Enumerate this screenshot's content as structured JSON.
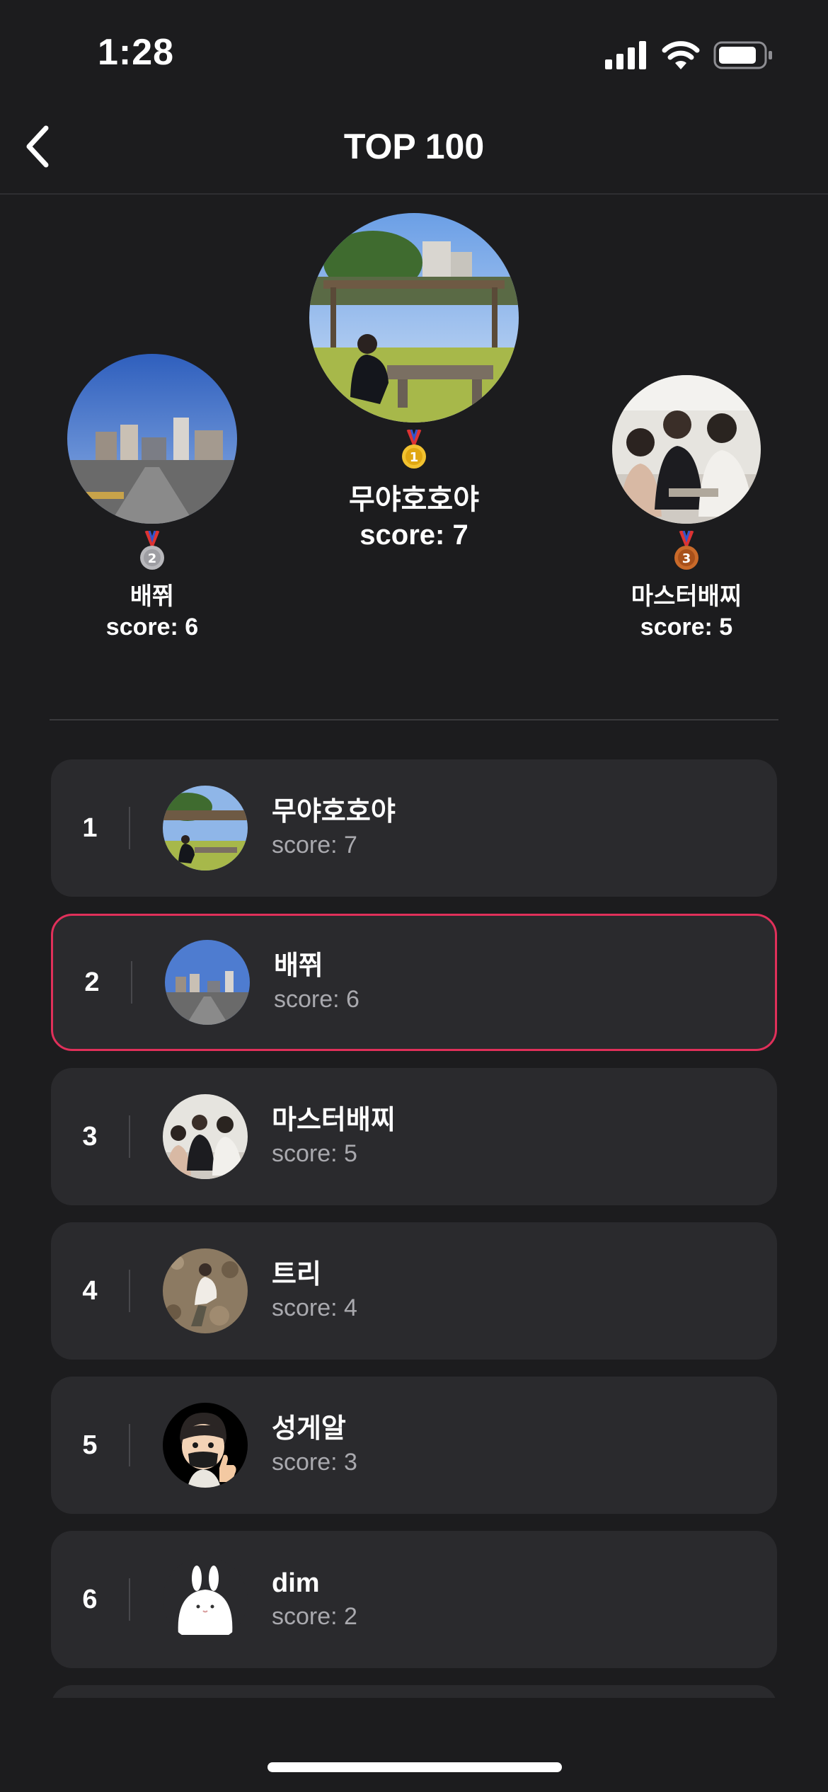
{
  "status_bar": {
    "time": "1:28"
  },
  "header": {
    "title": "TOP 100",
    "back_icon": "chevron-left-icon"
  },
  "podium": {
    "first": {
      "medal": "1",
      "name": "무야호호야",
      "score": "score: 7"
    },
    "second": {
      "medal": "2",
      "name": "배쮜",
      "score": "score: 6"
    },
    "third": {
      "medal": "3",
      "name": "마스터배찌",
      "score": "score: 5"
    }
  },
  "ranking": {
    "items": [
      {
        "rank": "1",
        "name": "무야호호야",
        "score": "score: 7",
        "avatar": "park-pavilion-photo"
      },
      {
        "rank": "2",
        "name": "배쮜",
        "score": "score: 6",
        "avatar": "city-street-photo",
        "highlighted": true
      },
      {
        "rank": "3",
        "name": "마스터배찌",
        "score": "score: 5",
        "avatar": "group-meeting-photo"
      },
      {
        "rank": "4",
        "name": "트리",
        "score": "score: 4",
        "avatar": "climbing-photo"
      },
      {
        "rank": "5",
        "name": "성게알",
        "score": "score: 3",
        "avatar": "memoji-thumbs-up"
      },
      {
        "rank": "6",
        "name": "dim",
        "score": "score: 2",
        "avatar": "white-bunny"
      }
    ]
  },
  "colors": {
    "background": "#1c1c1e",
    "card": "#2a2a2d",
    "highlight_border": "#e0305a",
    "secondary_text": "#a9a9ae"
  }
}
